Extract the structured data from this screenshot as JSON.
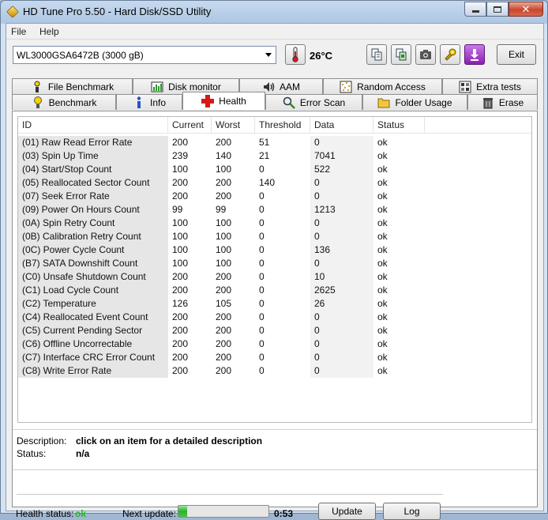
{
  "window": {
    "title": "HD Tune Pro 5.50 - Hard Disk/SSD Utility"
  },
  "menu": {
    "file": "File",
    "help": "Help"
  },
  "toolbar": {
    "drive": "WL3000GSA6472B (3000 gB)",
    "temperature": "26°C",
    "exit_label": "Exit"
  },
  "tabs_top": [
    "File Benchmark",
    "Disk monitor",
    "AAM",
    "Random Access",
    "Extra tests"
  ],
  "tabs_bottom": [
    "Benchmark",
    "Info",
    "Health",
    "Error Scan",
    "Folder Usage",
    "Erase"
  ],
  "active_tab": "Health",
  "table": {
    "headers": [
      "ID",
      "Current",
      "Worst",
      "Threshold",
      "Data",
      "Status"
    ],
    "rows": [
      [
        "(01) Raw Read Error Rate",
        "200",
        "200",
        "51",
        "0",
        "ok"
      ],
      [
        "(03) Spin Up Time",
        "239",
        "140",
        "21",
        "7041",
        "ok"
      ],
      [
        "(04) Start/Stop Count",
        "100",
        "100",
        "0",
        "522",
        "ok"
      ],
      [
        "(05) Reallocated Sector Count",
        "200",
        "200",
        "140",
        "0",
        "ok"
      ],
      [
        "(07) Seek Error Rate",
        "200",
        "200",
        "0",
        "0",
        "ok"
      ],
      [
        "(09) Power On Hours Count",
        "99",
        "99",
        "0",
        "1213",
        "ok"
      ],
      [
        "(0A) Spin Retry Count",
        "100",
        "100",
        "0",
        "0",
        "ok"
      ],
      [
        "(0B) Calibration Retry Count",
        "100",
        "100",
        "0",
        "0",
        "ok"
      ],
      [
        "(0C) Power Cycle Count",
        "100",
        "100",
        "0",
        "136",
        "ok"
      ],
      [
        "(B7) SATA Downshift Count",
        "100",
        "100",
        "0",
        "0",
        "ok"
      ],
      [
        "(C0) Unsafe Shutdown Count",
        "200",
        "200",
        "0",
        "10",
        "ok"
      ],
      [
        "(C1) Load Cycle Count",
        "200",
        "200",
        "0",
        "2625",
        "ok"
      ],
      [
        "(C2) Temperature",
        "126",
        "105",
        "0",
        "26",
        "ok"
      ],
      [
        "(C4) Reallocated Event Count",
        "200",
        "200",
        "0",
        "0",
        "ok"
      ],
      [
        "(C5) Current Pending Sector",
        "200",
        "200",
        "0",
        "0",
        "ok"
      ],
      [
        "(C6) Offline Uncorrectable",
        "200",
        "200",
        "0",
        "0",
        "ok"
      ],
      [
        "(C7) Interface CRC Error Count",
        "200",
        "200",
        "0",
        "0",
        "ok"
      ],
      [
        "(C8) Write Error Rate",
        "200",
        "200",
        "0",
        "0",
        "ok"
      ]
    ]
  },
  "details": {
    "description_label": "Description:",
    "description_value": "click on an item for a detailed description",
    "status_label": "Status:",
    "status_value": "n/a"
  },
  "footer": {
    "health_label": "Health status:",
    "health_value": "ok",
    "next_update_label": "Next update:",
    "next_update_progress": 0.1,
    "countdown": "0:53",
    "update_label": "Update",
    "log_label": "Log"
  },
  "colors": {
    "health_ok": "#2fb52f",
    "health_tab_icon": "#d61a1a"
  }
}
